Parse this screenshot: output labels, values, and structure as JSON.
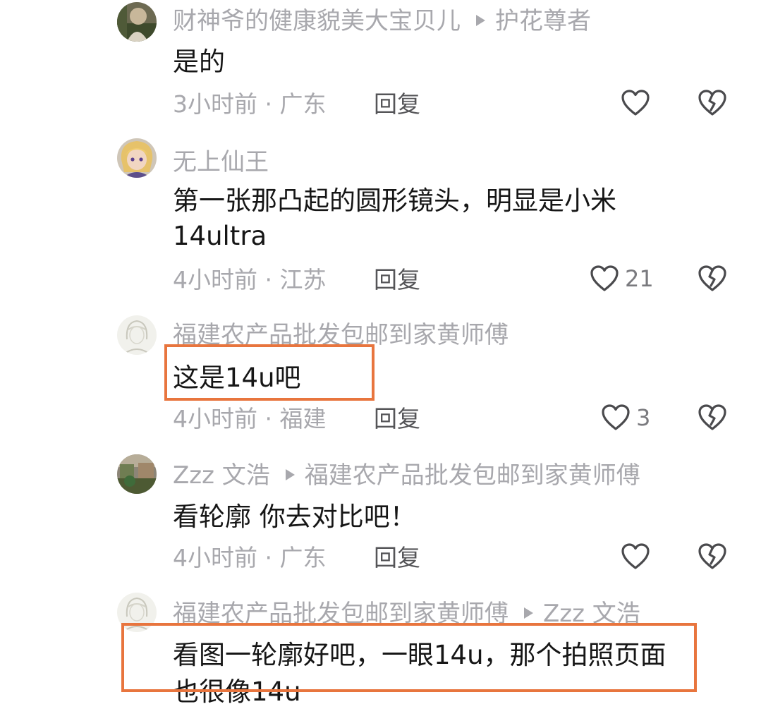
{
  "comments": [
    {
      "author": "财神爷的健康貌美大宝贝儿",
      "reply_to": "护花尊者",
      "text_lines": [
        "是的"
      ],
      "time": "3小时前",
      "location": "广东",
      "reply_label": "回复",
      "likes": "",
      "avatar_icon": "avatar-photo-icon"
    },
    {
      "author": "无上仙王",
      "reply_to": "",
      "text_lines": [
        "第一张那凸起的圆形镜头，明显是小米",
        "14ultra"
      ],
      "time": "4小时前",
      "location": "江苏",
      "reply_label": "回复",
      "likes": "21",
      "avatar_icon": "anime-avatar-icon"
    },
    {
      "author": "福建农产品批发包邮到家黄师傅",
      "reply_to": "",
      "text_lines": [
        "这是14u吧"
      ],
      "time": "4小时前",
      "location": "福建",
      "reply_label": "回复",
      "likes": "3",
      "avatar_icon": "sketch-avatar-icon"
    },
    {
      "author": "Zzz 文浩",
      "reply_to": "福建农产品批发包邮到家黄师傅",
      "text_lines": [
        "看轮廓 你去对比吧！"
      ],
      "time": "4小时前",
      "location": "广东",
      "reply_label": "回复",
      "likes": "",
      "avatar_icon": "photo-avatar-icon"
    },
    {
      "author": "福建农产品批发包邮到家黄师傅",
      "reply_to": "Zzz 文浩",
      "text_lines": [
        "看图一轮廓好吧，一眼14u，那个拍照页面",
        "也很像14u"
      ],
      "avatar_icon": "sketch-avatar-icon"
    }
  ],
  "meta_separator": " · ",
  "colors": {
    "highlight": "#e8753e",
    "meta_text": "#a8a8ad",
    "body_text": "#161616"
  }
}
